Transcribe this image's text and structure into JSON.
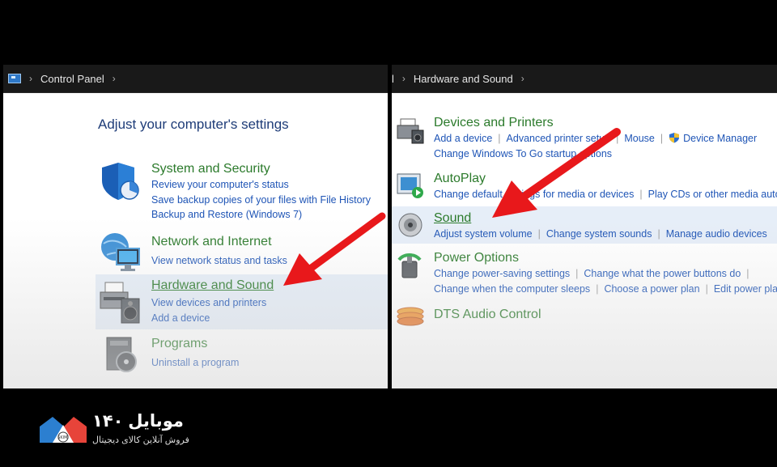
{
  "left": {
    "breadcrumb": [
      "Control Panel"
    ],
    "heading": "Adjust your computer's settings",
    "categories": [
      {
        "title": "System and Security",
        "links": [
          "Review your computer's status",
          "Save backup copies of your files with File History",
          "Backup and Restore (Windows 7)"
        ]
      },
      {
        "title": "Network and Internet",
        "links": [
          "View network status and tasks"
        ]
      },
      {
        "title": "Hardware and Sound",
        "links": [
          "View devices and printers",
          "Add a device"
        ]
      },
      {
        "title": "Programs",
        "links": [
          "Uninstall a program"
        ]
      }
    ]
  },
  "right": {
    "breadcrumb_prefix": "l",
    "breadcrumb": [
      "Hardware and Sound"
    ],
    "items": [
      {
        "title": "Devices and Printers",
        "row1": [
          "Add a device",
          "Advanced printer setup",
          "Mouse",
          "Device Manager"
        ],
        "row2": [
          "Change Windows To Go startup options"
        ]
      },
      {
        "title": "AutoPlay",
        "row1": [
          "Change default settings for media or devices",
          "Play CDs or other media automatically"
        ]
      },
      {
        "title": "Sound",
        "row1": [
          "Adjust system volume",
          "Change system sounds",
          "Manage audio devices"
        ]
      },
      {
        "title": "Power Options",
        "row1": [
          "Change power-saving settings",
          "Change what the power buttons do"
        ],
        "row2": [
          "Change when the computer sleeps",
          "Choose a power plan",
          "Edit power plan"
        ]
      },
      {
        "title": "DTS Audio Control"
      }
    ]
  },
  "brand": {
    "name": "موبایل ۱۴۰",
    "tagline": "فروش آنلاین کالای دیجیتال",
    "logo_text": "SKIMI"
  },
  "colors": {
    "title_green": "#2b7a2b",
    "link_blue": "#1f55b6",
    "heading_blue": "#1e3c78",
    "arrow_red": "#e8181b",
    "highlight": "#e6eef8"
  }
}
